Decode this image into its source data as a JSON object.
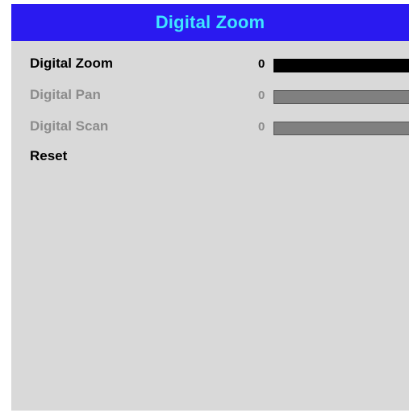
{
  "menu": {
    "title": "Digital Zoom",
    "header_color": "#2a1af0",
    "title_color": "#3ee6ff",
    "background_color": "#d9d9d9",
    "items": [
      {
        "label": "Digital Zoom",
        "value": "0",
        "state": "selected",
        "has_slider": true,
        "slider_level": 0
      },
      {
        "label": "Digital Pan",
        "value": "0",
        "state": "disabled",
        "has_slider": true,
        "slider_level": 0
      },
      {
        "label": "Digital Scan",
        "value": "0",
        "state": "disabled",
        "has_slider": true,
        "slider_level": 0
      },
      {
        "label": "Reset",
        "state": "enabled",
        "has_slider": false
      }
    ]
  }
}
